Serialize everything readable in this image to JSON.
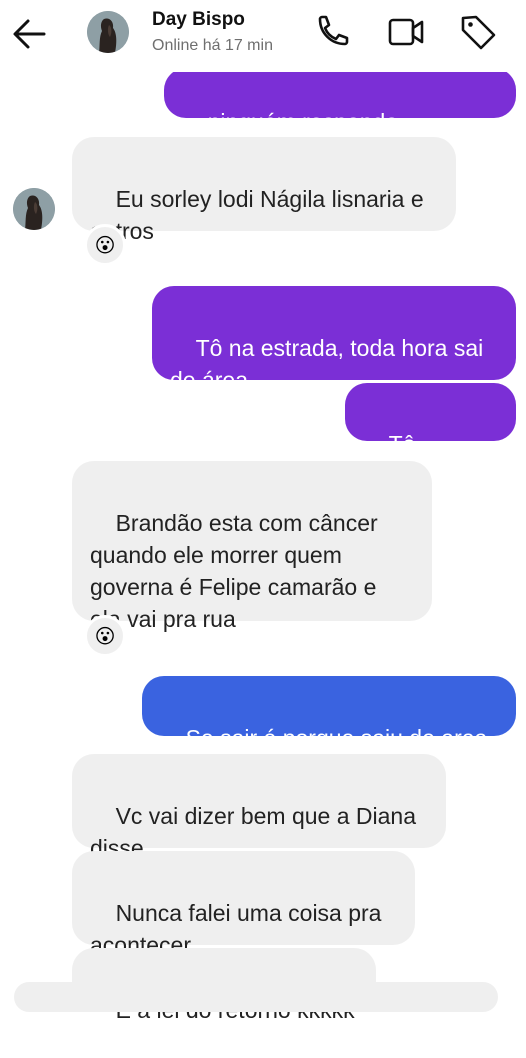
{
  "header": {
    "contact_name": "Day Bispo",
    "status": "Online há 17 min"
  },
  "messages": [
    {
      "text": "ninguém responde",
      "direction": "outgoing"
    },
    {
      "text": "Eu sorley lodi Nágila lisnaria e\noutros",
      "direction": "incoming",
      "reaction": "😮"
    },
    {
      "text": "Tô na estrada, toda hora sai\nde área",
      "direction": "outgoing"
    },
    {
      "text": "Tô viajando",
      "direction": "outgoing"
    },
    {
      "text": "Brandão esta com câncer\nquando ele morrer quem\ngoverna é Felipe camarão e\nela vai pra rua",
      "direction": "incoming",
      "reaction": "😮"
    },
    {
      "text": "Se sair é porque saiu de area",
      "direction": "outgoing"
    },
    {
      "text": "Vc vai dizer bem que a Diana\ndisse",
      "direction": "incoming"
    },
    {
      "text": "Nunca falei uma coisa pra\nacontecer",
      "direction": "incoming"
    },
    {
      "text": "É a lei do retorno kkkkk",
      "direction": "incoming"
    }
  ],
  "colors": {
    "outgoing_purple": "#7b2fd6",
    "outgoing_blue": "#3a63e0",
    "incoming": "#efefef"
  },
  "icons": {
    "back": "arrow-left-icon",
    "call": "phone-icon",
    "video": "video-camera-icon",
    "tag": "tag-icon"
  }
}
